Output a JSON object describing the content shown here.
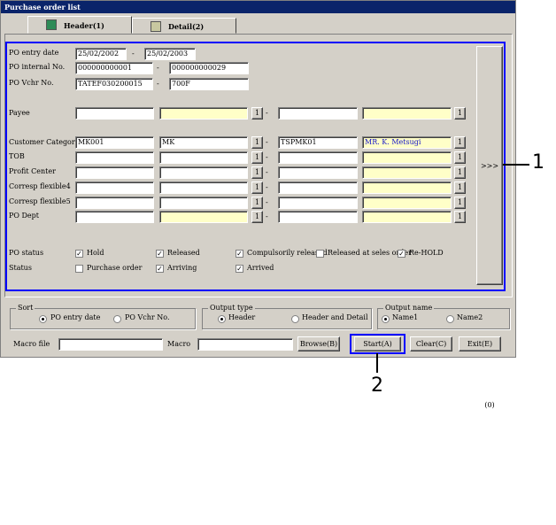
{
  "window": {
    "title": "Purchase order list"
  },
  "tabs": [
    {
      "label": "Header(1)",
      "icon": "book-icon"
    },
    {
      "label": "Detail(2)",
      "icon": "document-icon"
    }
  ],
  "fields": {
    "po_entry_date": {
      "label": "PO entry date",
      "from": "25/02/2002",
      "to": "25/02/2003"
    },
    "po_internal_no": {
      "label": "PO internal No.",
      "from": "000000000001",
      "to": "000000000029"
    },
    "po_vchr_no": {
      "label": "PO Vchr No.",
      "from": "TATEF030200015",
      "to": "700F"
    },
    "payee": {
      "label": "Payee",
      "from_code": "",
      "from_name": "",
      "to_code": "",
      "to_name": ""
    },
    "customer_category": {
      "label": "Customer Category",
      "from_code": "MK001",
      "from_name": "MK",
      "to_code": "TSPMK01",
      "to_name": "MR. K. Metsugi"
    },
    "tob": {
      "label": "TOB"
    },
    "profit_center": {
      "label": "Profit Center"
    },
    "corresp_flexible4": {
      "label": "Corresp flexible4"
    },
    "corresp_flexible5": {
      "label": "Corresp flexible5"
    },
    "po_dept": {
      "label": "PO Dept"
    }
  },
  "lookup_button": "1",
  "range_sep": "-",
  "more_button": ">>>(0)",
  "po_status": {
    "label": "PO status",
    "options": [
      {
        "label": "Hold",
        "checked": true
      },
      {
        "label": "Released",
        "checked": true
      },
      {
        "label": "Compulsorily released",
        "checked": true
      },
      {
        "label": "Released at seles order",
        "checked": false
      },
      {
        "label": "Re-HOLD",
        "checked": true
      }
    ]
  },
  "status": {
    "label": "Status",
    "options": [
      {
        "label": "Purchase order",
        "checked": false
      },
      {
        "label": "Arriving",
        "checked": true
      },
      {
        "label": "Arrived",
        "checked": true
      }
    ]
  },
  "sort": {
    "title": "Sort",
    "options": [
      "PO entry date",
      "PO Vchr No."
    ],
    "selected": 0
  },
  "output_type": {
    "title": "Output type",
    "options": [
      "Header",
      "Header and Detail"
    ],
    "selected": 0
  },
  "output_name": {
    "title": "Output name",
    "options": [
      "Name1",
      "Name2"
    ],
    "selected": 0
  },
  "bottom": {
    "macro_file_label": "Macro file",
    "macro_file_value": "",
    "macro_label": "Macro",
    "macro_value": "",
    "browse": "Browse(B)",
    "start": "Start(A)",
    "clear": "Clear(C)",
    "exit": "Exit(E)"
  },
  "callouts": {
    "one": "1",
    "two": "2"
  },
  "colors": {
    "title_bar": "#0a246a",
    "highlight": "#0000ff",
    "optional_field": "#ffffc8",
    "name_text": "#1414c8"
  }
}
